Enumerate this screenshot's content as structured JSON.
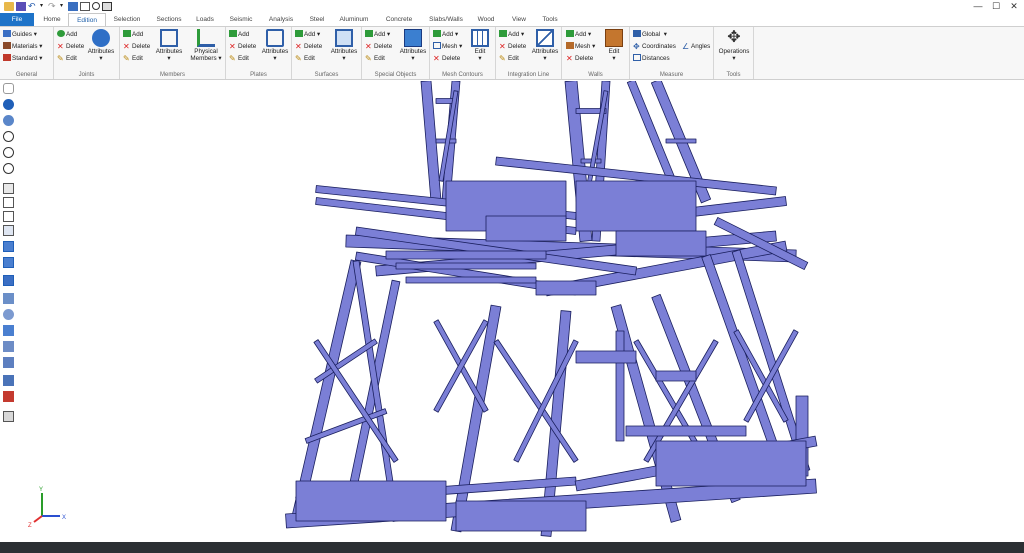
{
  "titlebar": {
    "minimize_glyph": "—",
    "maximize_glyph": "☐",
    "close_glyph": "✕"
  },
  "tabs": [
    {
      "label": "File"
    },
    {
      "label": "Home"
    },
    {
      "label": "Edition"
    },
    {
      "label": "Selection"
    },
    {
      "label": "Sections"
    },
    {
      "label": "Loads"
    },
    {
      "label": "Seismic"
    },
    {
      "label": "Analysis"
    },
    {
      "label": "Steel"
    },
    {
      "label": "Aluminum"
    },
    {
      "label": "Concrete"
    },
    {
      "label": "Slabs/Walls"
    },
    {
      "label": "Wood"
    },
    {
      "label": "View"
    },
    {
      "label": "Tools"
    }
  ],
  "ribbon": {
    "general": {
      "label": "General",
      "guides": "Guides",
      "materials": "Materials",
      "standard": "Standard"
    },
    "joints": {
      "label": "Joints",
      "add": "Add",
      "delete": "Delete",
      "edit": "Edit",
      "attributes": "Attributes"
    },
    "members": {
      "label": "Members",
      "add": "Add",
      "delete": "Delete",
      "edit": "Edit",
      "attributes": "Attributes",
      "physical_members": "Physical Members"
    },
    "plates": {
      "label": "Plates",
      "add": "Add",
      "delete": "Delete",
      "edit": "Edit",
      "attributes": "Attributes"
    },
    "surfaces": {
      "label": "Surfaces",
      "add": "Add",
      "delete": "Delete",
      "edit": "Edit",
      "attributes": "Attributes"
    },
    "special_objects": {
      "label": "Special Objects",
      "add": "Add",
      "delete": "Delete",
      "edit": "Edit",
      "attributes": "Attributes"
    },
    "mesh_contours": {
      "label": "Mesh Contours",
      "add": "Add",
      "mesh": "Mesh",
      "delete": "Delete",
      "edit": "Edit"
    },
    "integration_line": {
      "label": "Integration Line",
      "add": "Add",
      "delete": "Delete",
      "edit": "Edit",
      "attributes": "Attributes"
    },
    "walls": {
      "label": "Walls",
      "add": "Add",
      "mesh": "Mesh",
      "delete": "Delete",
      "edit": "Edit"
    },
    "measure": {
      "label": "Measure",
      "global": "Global",
      "angles": "Angles",
      "coordinates": "Coordinates",
      "distances": "Distances"
    },
    "tools": {
      "label": "Tools",
      "operations": "Operations"
    }
  },
  "axes": {
    "x": "X",
    "y": "Y",
    "z": "Z"
  },
  "colors": {
    "accent": "#1e73c8",
    "model_fill": "#7b7fd6",
    "model_edge": "#1a1f5e",
    "axis_x": "#e03030",
    "axis_y": "#2a9d2a",
    "axis_z": "#2a4fd0",
    "statusbar": "#2b2f33"
  }
}
